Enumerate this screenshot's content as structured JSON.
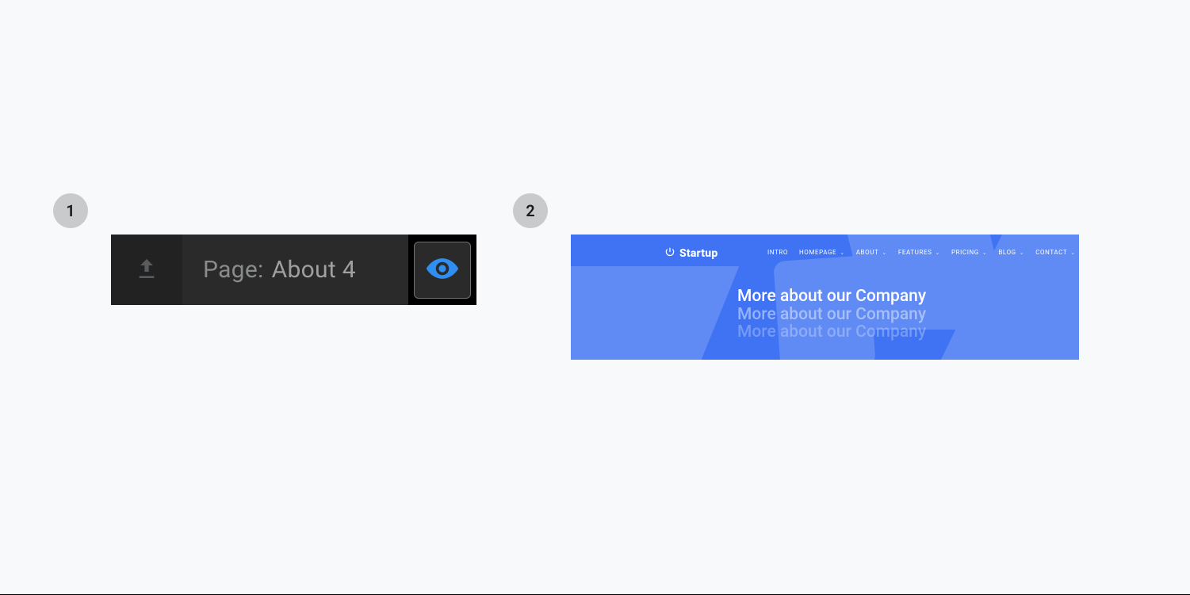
{
  "steps": {
    "one": "1",
    "two": "2"
  },
  "toolbar": {
    "page_label": "Page:",
    "page_value": "About 4"
  },
  "hero": {
    "brand": "Startup",
    "menu": [
      {
        "label": "INTRO",
        "dropdown": false
      },
      {
        "label": "HOMEPAGE",
        "dropdown": true
      },
      {
        "label": "ABOUT",
        "dropdown": true
      },
      {
        "label": "FEATURES",
        "dropdown": true
      },
      {
        "label": "PRICING",
        "dropdown": true
      },
      {
        "label": "BLOG",
        "dropdown": true
      },
      {
        "label": "CONTACT",
        "dropdown": true
      }
    ],
    "heading": "More about our Company"
  }
}
